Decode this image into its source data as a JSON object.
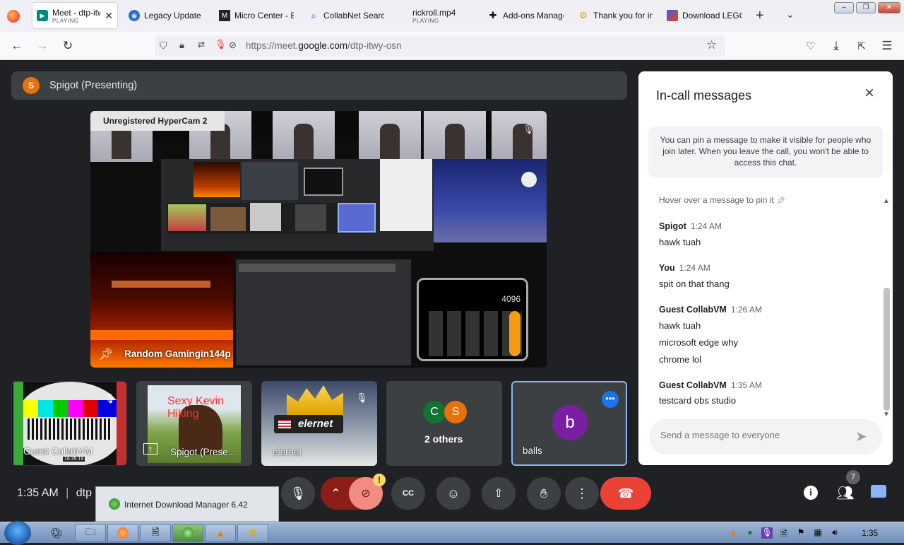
{
  "browser": {
    "tabs": [
      {
        "label": "Meet - dtp-itwy-osn",
        "sub": "PLAYING",
        "active": true,
        "icon": "meet-icon"
      },
      {
        "label": "Legacy Update",
        "icon": "globe-icon"
      },
      {
        "label": "Micro Center - E",
        "icon": "microcenter-icon"
      },
      {
        "label": "CollabNet Search",
        "icon": "search-icon"
      },
      {
        "label": "rickroll.mp4",
        "sub": "PLAYING",
        "icon": "video-icon"
      },
      {
        "label": "Add-ons Manager",
        "icon": "puzzle-icon"
      },
      {
        "label": "Thank you for in",
        "icon": "gear-icon"
      },
      {
        "label": "Download LEGO",
        "icon": "lego-icon"
      }
    ],
    "url_prefix": "https://meet.",
    "url_domain": "google.com",
    "url_path": "/dtp-itwy-osn"
  },
  "meet": {
    "presenter_initial": "S",
    "presenter_label": "Spigot (Presenting)",
    "stage_overlay": "Unregistered HyperCam 2",
    "stage_name": "Random Gamingin144p",
    "calc_display": "4096",
    "tiles": [
      {
        "name": "Guest CollabVM",
        "sub": "16:35:19"
      },
      {
        "name": "Spigot (Prese...",
        "overlay": "Sexy Kevin Hiking"
      },
      {
        "name": "elernet",
        "overlay": "elernet"
      },
      {
        "name": "2 others",
        "initials": [
          "C",
          "S"
        ]
      },
      {
        "name": "balls",
        "initial": "b"
      }
    ],
    "time": "1:35 AM",
    "meeting_code_partial": "dtp",
    "people_count": "7",
    "notification_badge": "!"
  },
  "chat": {
    "title": "In-call messages",
    "pin_note": "You can pin a message to make it visible for people who join later. When you leave the call, you won't be able to access this chat.",
    "hover_note": "Hover over a message to pin it",
    "messages": [
      {
        "sender": "Spigot",
        "time": "1:24 AM",
        "lines": [
          "hawk tuah"
        ]
      },
      {
        "sender": "You",
        "time": "1:24 AM",
        "lines": [
          "spit on that thang"
        ]
      },
      {
        "sender": "Guest CollabVM",
        "time": "1:26 AM",
        "lines": [
          "hawk tuah",
          "microsoft edge why",
          "chrome lol"
        ]
      },
      {
        "sender": "Guest CollabVM",
        "time": "1:35 AM",
        "lines": [
          "testcard obs studio"
        ]
      }
    ],
    "input_placeholder": "Send a message to everyone"
  },
  "idm_popup": "Internet Download Manager 6.42",
  "taskbar": {
    "clock": "1:35"
  },
  "colors": {
    "meet_bg": "#202124",
    "end_call": "#ea4335",
    "accent_blue": "#1a73e8",
    "avatar_orange": "#e8710a",
    "avatar_teal": "#137333",
    "avatar_purple": "#7b1fa2"
  }
}
